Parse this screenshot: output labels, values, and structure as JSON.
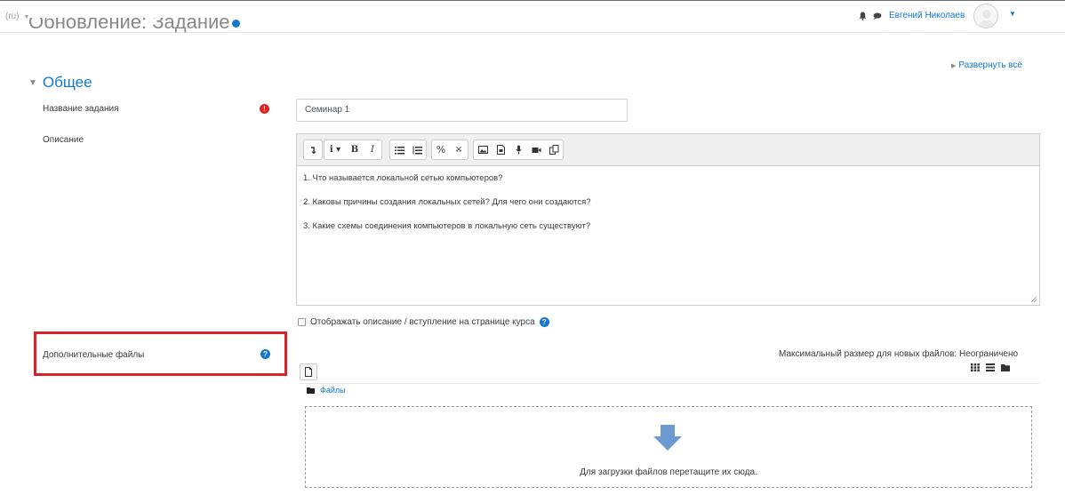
{
  "header": {
    "lang_label": "(ru)",
    "lang_caret": "▼",
    "user_name": "Евгений Николаев",
    "user_caret": "▼"
  },
  "page": {
    "title": "Обновление: Задание",
    "expand_all": "Развернуть всё"
  },
  "section": {
    "legend": "Общее"
  },
  "form": {
    "name_label": "Название задания",
    "name_value": "Семинар 1",
    "required_icon": "!",
    "description_label": "Описание",
    "description_lines": [
      "1. Что называется локальной сетью компьютеров?",
      "2. Каковы причины создания локальных сетей? Для чего они создаются?",
      "3. Какие схемы соединения компьютеров в локальную сеть существуют?"
    ],
    "show_description_label": "Отображать описание / вступление на странице курса",
    "help_icon": "?",
    "files_label": "Дополнительные файлы",
    "max_size": "Максимальный размер для новых файлов: Неограничено",
    "files_path": "Файлы",
    "drop_text": "Для загрузки файлов перетащите их сюда."
  },
  "toolbar": {
    "bold": "B",
    "italic": "I"
  },
  "colors": {
    "accent": "#1177d1",
    "required": "#e02424",
    "highlight_box": "#d9222a",
    "upload_arrow": "#6d9bd1"
  }
}
